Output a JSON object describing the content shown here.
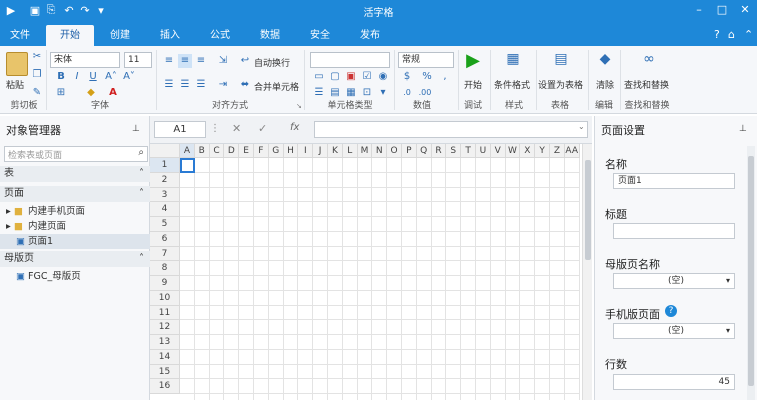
{
  "window": {
    "title": "活字格",
    "minimize": "–",
    "maximize": "□",
    "close": "✕"
  },
  "tabs": [
    {
      "label": "文件",
      "active": false
    },
    {
      "label": "开始",
      "active": true
    },
    {
      "label": "创建",
      "active": false
    },
    {
      "label": "插入",
      "active": false
    },
    {
      "label": "公式",
      "active": false
    },
    {
      "label": "数据",
      "active": false
    },
    {
      "label": "安全",
      "active": false
    },
    {
      "label": "发布",
      "active": false
    }
  ],
  "ribbon": {
    "clipboard": {
      "paste": "粘贴",
      "group": "剪切板"
    },
    "font": {
      "family": "宋体",
      "size": "11",
      "bold": "B",
      "italic": "I",
      "underline": "U",
      "color_a": "A",
      "group": "字体"
    },
    "align": {
      "wrap": "自动换行",
      "merge": "合并单元格",
      "group": "对齐方式"
    },
    "celltype": {
      "group": "单元格类型"
    },
    "number": {
      "format": "常规",
      "percent": "%",
      "comma": ",",
      "group": "数值"
    },
    "debug": {
      "start": "开始",
      "group": "调试"
    },
    "style": {
      "conditional": "条件格式",
      "group": "样式"
    },
    "table": {
      "set_table": "设置为表格",
      "group": "表格"
    },
    "edit": {
      "clear": "清除",
      "group": "编辑"
    },
    "find": {
      "find_replace": "查找和替换",
      "group": "查找和替换"
    }
  },
  "formula_bar": {
    "cell": "A1",
    "cancel": "✕",
    "confirm": "✓",
    "fx": "fx"
  },
  "left_panel": {
    "title": "对象管理器",
    "search_placeholder": "检索表或页面",
    "sections": [
      {
        "label": "表"
      },
      {
        "label": "页面"
      },
      {
        "label": "母版页"
      }
    ],
    "page_items": [
      "内建手机页面",
      "内建页面",
      "页面1"
    ],
    "master_items": [
      "FGC_母版页"
    ]
  },
  "grid": {
    "columns": [
      "A",
      "B",
      "C",
      "D",
      "E",
      "F",
      "G",
      "H",
      "I",
      "J",
      "K",
      "L",
      "M",
      "N",
      "O",
      "P",
      "Q",
      "R",
      "S",
      "T",
      "U",
      "V",
      "W",
      "X",
      "Y",
      "Z",
      "AA"
    ],
    "rows": [
      "1",
      "2",
      "3",
      "4",
      "5",
      "6",
      "7",
      "8",
      "9",
      "10",
      "11",
      "12",
      "13",
      "14",
      "15",
      "16"
    ]
  },
  "right_panel": {
    "title": "页面设置",
    "name_label": "名称",
    "name_value": "页面1",
    "title_label": "标题",
    "title_value": "",
    "master_label": "母版页名称",
    "master_value": "(空)",
    "mobile_master_label": "手机版页面",
    "mobile_master_value": "(空)",
    "rows_label": "行数",
    "rows_value": "45"
  }
}
